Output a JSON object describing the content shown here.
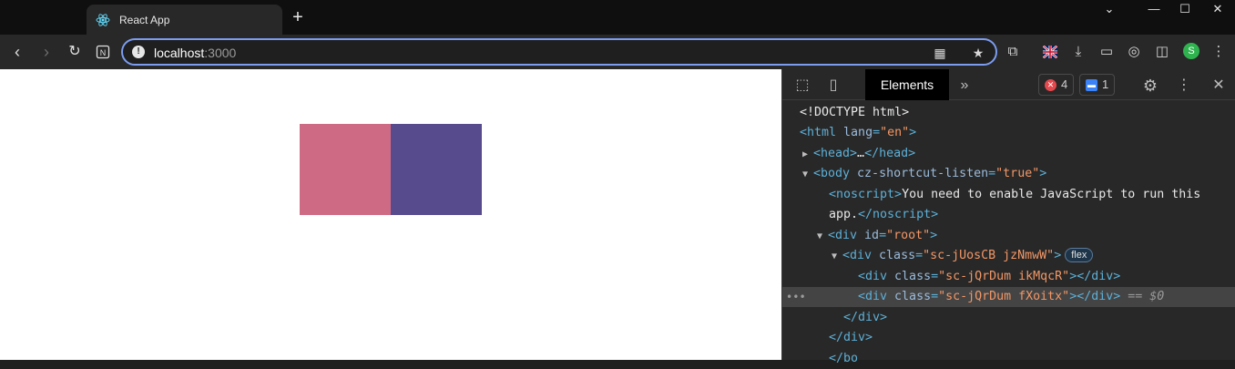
{
  "browser": {
    "tab_title": "React App",
    "new_tab_symbol": "+",
    "url_host": "localhost",
    "url_port": ":3000",
    "profile_initial": "S",
    "window_controls": {
      "dropdown": "⌄",
      "minimize": "—",
      "maximize": "☐",
      "close": "✕"
    }
  },
  "page": {
    "boxes": [
      {
        "name": "box-pink",
        "color": "#cf6a85"
      },
      {
        "name": "box-purple",
        "color": "#574b8e"
      }
    ]
  },
  "devtools": {
    "active_tab": "Elements",
    "more_tabs": "»",
    "error_count": "4",
    "message_count": "1",
    "dom": {
      "doctype": "<!DOCTYPE html>",
      "html_open": "<html",
      "html_lang_attr": "lang",
      "html_lang_val": "\"en\"",
      "head_open": "<head>",
      "head_ellipsis": "…",
      "head_close": "</head>",
      "body_open": "<body",
      "body_attr": "cz-shortcut-listen",
      "body_attr_val": "\"true\"",
      "noscript_open": "<noscript>",
      "noscript_text_1": "You need to enable JavaScript to run this",
      "noscript_text_2": "app.",
      "noscript_close": "</noscript>",
      "root_open": "<div",
      "id_attr": "id",
      "root_id_val": "\"root\"",
      "flex_div_open": "<div",
      "class_attr": "class",
      "flex_div_class": "\"sc-jUosCB jzNmwW\"",
      "flex_badge": "flex",
      "child1_open": "<div",
      "child1_class": "\"sc-jQrDum ikMqcR\"",
      "child2_open": "<div",
      "child2_class": "\"sc-jQrDum fXoitx\"",
      "div_close": "</div>",
      "selected_suffix": "== $0",
      "dots": "•••",
      "partial_line": "</bo"
    }
  }
}
